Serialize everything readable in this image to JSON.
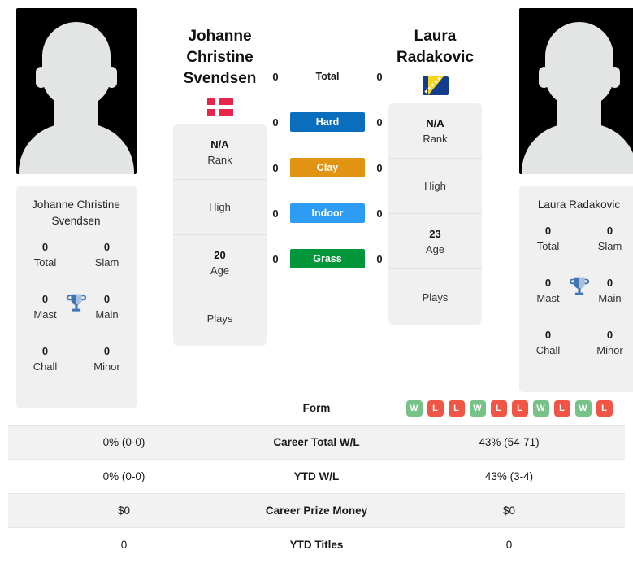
{
  "players": {
    "left": {
      "name_display": "Johanne\nChristine\nSvendsen",
      "name_line1": "Johanne",
      "name_line2": "Christine",
      "name_line3": "Svendsen",
      "name_full": "Johanne Christine Svendsen",
      "flag": "denmark-flag",
      "rank_value": "N/A",
      "rank_label": "Rank",
      "high_label": "High",
      "age_value": "20",
      "age_label": "Age",
      "plays_label": "Plays",
      "titles": [
        {
          "value": "0",
          "label": "Total"
        },
        {
          "value": "0",
          "label": "Slam"
        },
        {
          "value": "0",
          "label": "Mast"
        },
        {
          "value": "0",
          "label": "Main"
        },
        {
          "value": "0",
          "label": "Chall"
        },
        {
          "value": "0",
          "label": "Minor"
        }
      ],
      "career_total_wl": "0% (0-0)",
      "ytd_wl": "0% (0-0)",
      "career_prize_money": "$0",
      "ytd_titles": "0",
      "form": []
    },
    "right": {
      "name_line1": "Laura",
      "name_line2": "Radakovic",
      "name_line3": "",
      "name_full": "Laura Radakovic",
      "flag": "bosnia-herzegovina-flag",
      "rank_value": "N/A",
      "rank_label": "Rank",
      "high_label": "High",
      "age_value": "23",
      "age_label": "Age",
      "plays_label": "Plays",
      "titles": [
        {
          "value": "0",
          "label": "Total"
        },
        {
          "value": "0",
          "label": "Slam"
        },
        {
          "value": "0",
          "label": "Mast"
        },
        {
          "value": "0",
          "label": "Main"
        },
        {
          "value": "0",
          "label": "Chall"
        },
        {
          "value": "0",
          "label": "Minor"
        }
      ],
      "career_total_wl": "43% (54-71)",
      "ytd_wl": "43% (3-4)",
      "career_prize_money": "$0",
      "ytd_titles": "0",
      "form": [
        "W",
        "L",
        "L",
        "W",
        "L",
        "L",
        "W",
        "L",
        "W",
        "L"
      ]
    }
  },
  "head_to_head": {
    "rows": [
      {
        "label": "Total",
        "left": "0",
        "right": "0",
        "color": "",
        "plain": true
      },
      {
        "label": "Hard",
        "left": "0",
        "right": "0",
        "color": "#0a6ebd",
        "plain": false
      },
      {
        "label": "Clay",
        "left": "0",
        "right": "0",
        "color": "#e09412",
        "plain": false
      },
      {
        "label": "Indoor",
        "left": "0",
        "right": "0",
        "color": "#2d9cf5",
        "plain": false
      },
      {
        "label": "Grass",
        "left": "0",
        "right": "0",
        "color": "#009639",
        "plain": false
      }
    ]
  },
  "stats_table": {
    "rows": [
      {
        "label": "Form",
        "left": "",
        "right": "",
        "type": "form"
      },
      {
        "label": "Career Total W/L",
        "left": "0% (0-0)",
        "right": "43% (54-71)",
        "type": "text"
      },
      {
        "label": "YTD W/L",
        "left": "0% (0-0)",
        "right": "43% (3-4)",
        "type": "text"
      },
      {
        "label": "Career Prize Money",
        "left": "$0",
        "right": "$0",
        "type": "text"
      },
      {
        "label": "YTD Titles",
        "left": "0",
        "right": "0",
        "type": "text"
      }
    ]
  },
  "colors": {
    "hard": "#0a6ebd",
    "clay": "#e09412",
    "indoor": "#2d9cf5",
    "grass": "#009639",
    "win": "#77c288",
    "loss": "#f05545",
    "card_bg": "#f0f0f0",
    "trophy": "#3f74b5"
  }
}
